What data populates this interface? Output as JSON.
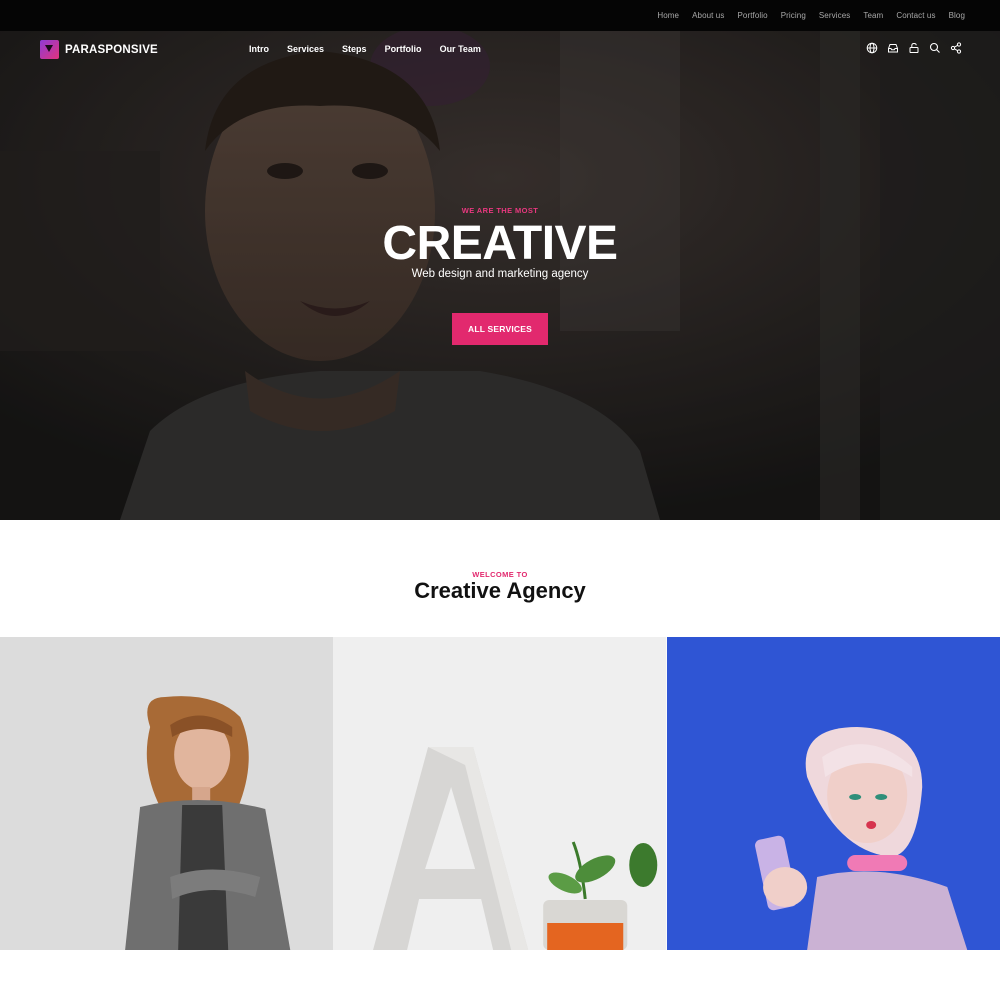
{
  "top_nav": [
    "Home",
    "About us",
    "Portfolio",
    "Pricing",
    "Services",
    "Team",
    "Contact us",
    "Blog"
  ],
  "brand": {
    "name": "PARASPONSIVE"
  },
  "main_nav": [
    "Intro",
    "Services",
    "Steps",
    "Portfolio",
    "Our Team"
  ],
  "nav_icons": [
    "globe-icon",
    "inbox-icon",
    "lock-icon",
    "search-icon",
    "share-icon"
  ],
  "hero": {
    "kicker": "WE ARE THE MOST",
    "title": "CREATIVE",
    "subtitle": "Web design and marketing agency",
    "button_label": "ALL SERVICES"
  },
  "welcome": {
    "kicker": "WELCOME TO",
    "title": "Creative Agency"
  },
  "colors": {
    "accent": "#e2296e",
    "topbar": "#050505",
    "blue_panel": "#2f55d4"
  }
}
